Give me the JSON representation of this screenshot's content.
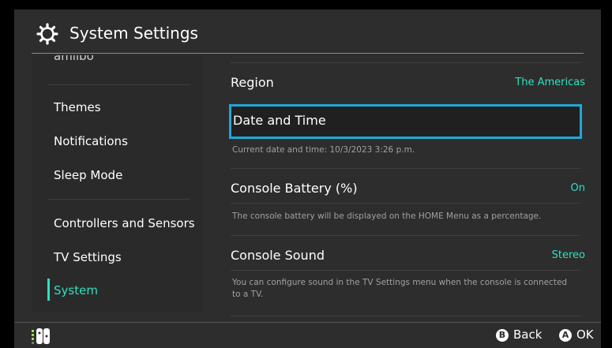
{
  "header": {
    "title": "System Settings",
    "icon": "gear-icon"
  },
  "sidebar": {
    "items": [
      {
        "label": "amiibo"
      },
      {
        "label": "Themes"
      },
      {
        "label": "Notifications"
      },
      {
        "label": "Sleep Mode"
      },
      {
        "label": "Controllers and Sensors"
      },
      {
        "label": "TV Settings"
      },
      {
        "label": "System",
        "active": true
      }
    ]
  },
  "main": {
    "region": {
      "label": "Region",
      "value": "The Americas"
    },
    "date_time": {
      "label": "Date and Time",
      "desc": "Current date and time: 10/3/2023 3:26 p.m."
    },
    "battery": {
      "label": "Console Battery (%)",
      "value": "On",
      "desc": "The console battery will be displayed on the HOME Menu as a percentage."
    },
    "sound": {
      "label": "Console Sound",
      "value": "Stereo",
      "desc": "You can configure sound in the TV Settings menu when the console is connected to a TV."
    }
  },
  "footer": {
    "back": {
      "button": "B",
      "label": "Back"
    },
    "ok": {
      "button": "A",
      "label": "OK"
    }
  },
  "colors": {
    "accent": "#2fe0c0",
    "selection": "#1fa8d8",
    "background": "#2d2d2d"
  }
}
